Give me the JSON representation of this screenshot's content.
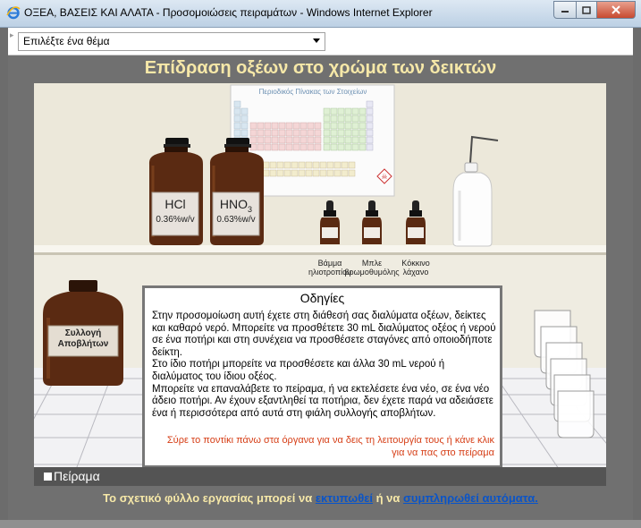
{
  "window": {
    "title": "ΟΞΕΑ, ΒΑΣΕΙΣ ΚΑΙ ΑΛΑΤΑ - Προσομοιώσεις πειραμάτων - Windows Internet Explorer",
    "icon": "ie-icon",
    "buttons": [
      "minimize-icon",
      "maximize-icon",
      "close-icon"
    ]
  },
  "topbar": {
    "topic_select": "Επιλέξτε ένα θέμα"
  },
  "page": {
    "title": "Επίδραση οξέων στο χρώμα των δεικτών"
  },
  "lab": {
    "periodic_table_title": "Περιοδικός Πίνακας των Στοιχείων",
    "bottles": [
      {
        "name": "HCl",
        "concentration": "0.36%w/v"
      },
      {
        "name": "HNO",
        "subscript": "3",
        "concentration": "0.63%w/v"
      }
    ],
    "indicators": [
      {
        "label_line1": "Βάμμα",
        "label_line2": "ηλιοτροπίου"
      },
      {
        "label_line1": "Μπλε",
        "label_line2": "βρωμοθυμόλης"
      },
      {
        "label_line1": "Κόκκινο",
        "label_line2": "λάχανο"
      }
    ],
    "waste_jar": {
      "line1": "Συλλογή",
      "line2": "Αποβλήτων"
    }
  },
  "instructions": {
    "title": "Οδηγίες",
    "paragraphs": [
      "Στην προσομοίωση αυτή έχετε στη διάθεσή σας διαλύματα οξέων, δείκτες και καθαρό νερό. Μπορείτε να προσθέτετε  30 mL διαλύματος οξέος ή νερού σε ένα ποτήρι και στη συνέχεια να προσθέσετε σταγόνες από οποιοδήποτε δείκτη.",
      "Στο ίδιο ποτήρι μπορείτε να προσθέσετε και άλλα 30 mL νερού ή διαλύματος του ίδιου οξέος.",
      "Μπορείτε να επαναλάβετε το πείραμα, ή να εκτελέσετε ένα νέο, σε ένα νέο άδειο ποτήρι. Αν έχουν εξαντληθεί τα ποτήρια, δεν έχετε παρά να αδειάσετε ένα ή περισσότερα από αυτά στη φιάλη συλλογής αποβλήτων."
    ],
    "hint": "Σύρε το ποντίκι πάνω στα όργανα για να δεις τη λειτουργία τους ή κάνε κλικ για να πας στο πείραμα"
  },
  "tab": {
    "label": "Πείραμα"
  },
  "footer": {
    "prefix": "Το σχετικό φύλλο εργασίας μπορεί να",
    "link_print": "εκτυπωθεί",
    "middle": "ή να",
    "link_fill": "συμπληρωθεί αυτόματα."
  },
  "colors": {
    "title_text": "#f6e8a8",
    "link": "#0a54c8",
    "hint_text": "#d63e16",
    "bottle_glass": "#5a2a12"
  }
}
